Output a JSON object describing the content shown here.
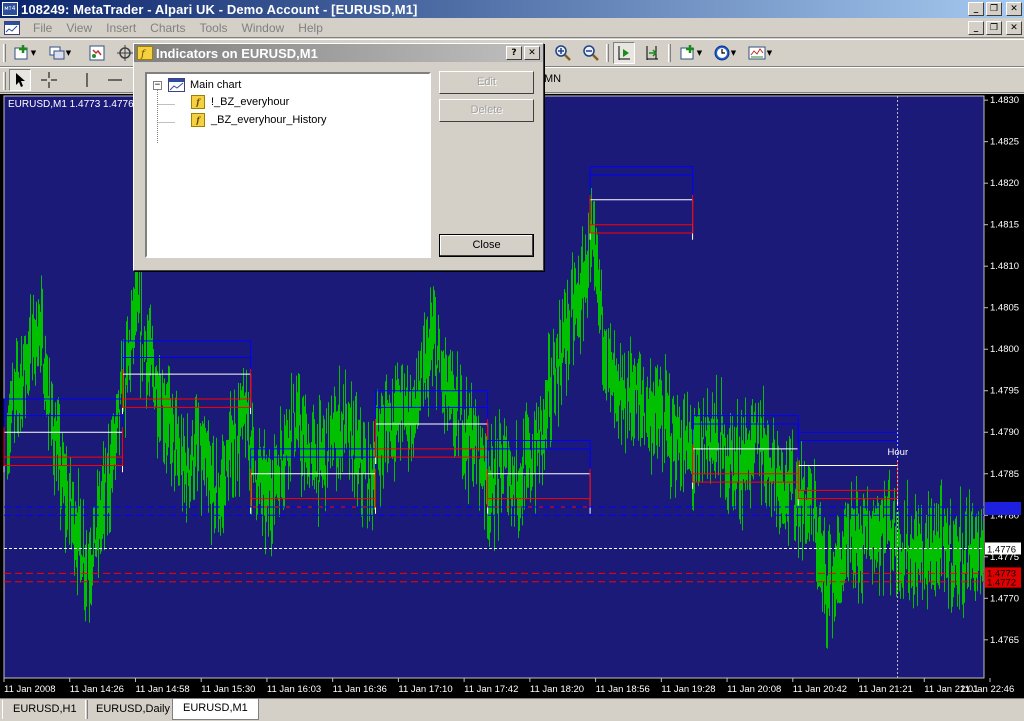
{
  "window": {
    "app_icon": "мт4",
    "title": "108249: MetaTrader - Alpari UK - Demo Account - [EURUSD,M1]"
  },
  "menu": [
    "File",
    "View",
    "Insert",
    "Charts",
    "Tools",
    "Window",
    "Help"
  ],
  "toolbar": {
    "period_label": "MN"
  },
  "chart": {
    "header": "EURUSD,M1  1.4773 1.4776",
    "indicator_label": "Hour",
    "bid_label": "1.4776",
    "blue_label": "",
    "red_label_1": "1.4773",
    "red_label_2": "1.4772",
    "colors": {
      "background": "#1c1a78",
      "candles": "#00c000",
      "upper": "#0000ff",
      "mid": "#ffffff",
      "lower": "#ff0000",
      "price_scale_bg": "#000000"
    }
  },
  "chart_data": {
    "type": "bar",
    "symbol": "EURUSD",
    "timeframe": "M1",
    "y_ticks": [
      1.483,
      1.4825,
      1.482,
      1.4815,
      1.481,
      1.4805,
      1.48,
      1.4795,
      1.479,
      1.4785,
      1.478,
      1.4775,
      1.477,
      1.4765
    ],
    "y_tick_labels": [
      "1.4830",
      "1.4825",
      "1.4820",
      "1.4815",
      "1.4810",
      "1.4805",
      "1.4800",
      "1.4795",
      "1.4790",
      "1.4785",
      "1.4780",
      "1.4775",
      "1.4770",
      "1.4765"
    ],
    "ylim": [
      1.476,
      1.4831
    ],
    "x_tick_labels": [
      "11 Jan 2008",
      "11 Jan 14:26",
      "11 Jan 14:58",
      "11 Jan 15:30",
      "11 Jan 16:03",
      "11 Jan 16:36",
      "11 Jan 17:10",
      "11 Jan 17:42",
      "11 Jan 18:20",
      "11 Jan 18:56",
      "11 Jan 19:28",
      "11 Jan 20:08",
      "11 Jan 20:42",
      "11 Jan 21:21",
      "11 Jan 22:01",
      "11 Jan 22:46"
    ],
    "hour_levels": [
      {
        "x0": 0.0,
        "x1": 1.85,
        "upper": [
          1.4794,
          1.4792
        ],
        "mid": 1.479,
        "lower": [
          1.4787,
          1.4786
        ]
      },
      {
        "x0": 1.85,
        "x1": 3.85,
        "upper": [
          1.4801,
          1.4799
        ],
        "mid": 1.4797,
        "lower": [
          1.4794,
          1.4793
        ]
      },
      {
        "x0": 3.85,
        "x1": 5.8,
        "upper": [
          1.4788,
          1.4787
        ],
        "mid": 1.4785,
        "lower": [
          1.4782,
          1.4781
        ]
      },
      {
        "x0": 5.8,
        "x1": 7.55,
        "upper": [
          1.4795,
          1.4793
        ],
        "mid": 1.4791,
        "lower": [
          1.4788,
          1.4787
        ]
      },
      {
        "x0": 7.55,
        "x1": 9.15,
        "upper": [
          1.4789,
          1.4788
        ],
        "mid": 1.4785,
        "lower": [
          1.4782,
          1.4781
        ]
      },
      {
        "x0": 9.15,
        "x1": 10.75,
        "upper": [
          1.4822,
          1.4821
        ],
        "mid": 1.4818,
        "lower": [
          1.4815,
          1.4814
        ]
      },
      {
        "x0": 10.75,
        "x1": 12.4,
        "upper": [
          1.4792,
          1.4791
        ],
        "mid": 1.4788,
        "lower": [
          1.4785,
          1.4784
        ]
      },
      {
        "x0": 12.4,
        "x1": 13.95,
        "upper": [
          1.479,
          1.4789
        ],
        "mid": 1.4786,
        "lower": [
          1.4783,
          1.4782
        ]
      }
    ],
    "dashed_levels": {
      "blue": [
        1.4781,
        1.478
      ],
      "white": 1.4776,
      "red": [
        1.4773,
        1.4772
      ]
    },
    "hour_marker_x": 13.95,
    "price_path": [
      [
        0.0,
        1.4788
      ],
      [
        0.2,
        1.4795
      ],
      [
        0.4,
        1.48
      ],
      [
        0.55,
        1.4803
      ],
      [
        0.7,
        1.4793
      ],
      [
        0.9,
        1.4784
      ],
      [
        1.1,
        1.4779
      ],
      [
        1.3,
        1.4774
      ],
      [
        1.45,
        1.4778
      ],
      [
        1.6,
        1.4783
      ],
      [
        1.75,
        1.479
      ],
      [
        1.9,
        1.4797
      ],
      [
        2.05,
        1.4805
      ],
      [
        2.2,
        1.48
      ],
      [
        2.4,
        1.4795
      ],
      [
        2.6,
        1.479
      ],
      [
        2.8,
        1.4785
      ],
      [
        3.0,
        1.4788
      ],
      [
        3.2,
        1.4784
      ],
      [
        3.35,
        1.4782
      ],
      [
        3.55,
        1.4788
      ],
      [
        3.75,
        1.4792
      ],
      [
        3.9,
        1.4786
      ],
      [
        4.1,
        1.4782
      ],
      [
        4.3,
        1.4786
      ],
      [
        4.5,
        1.4792
      ],
      [
        4.7,
        1.4788
      ],
      [
        4.9,
        1.4786
      ],
      [
        5.1,
        1.4789
      ],
      [
        5.3,
        1.4791
      ],
      [
        5.5,
        1.4787
      ],
      [
        5.7,
        1.4784
      ],
      [
        5.85,
        1.4789
      ],
      [
        6.0,
        1.4791
      ],
      [
        6.2,
        1.4793
      ],
      [
        6.4,
        1.4792
      ],
      [
        6.55,
        1.4797
      ],
      [
        6.7,
        1.4801
      ],
      [
        6.85,
        1.4796
      ],
      [
        7.05,
        1.4792
      ],
      [
        7.25,
        1.479
      ],
      [
        7.45,
        1.4787
      ],
      [
        7.6,
        1.4783
      ],
      [
        7.8,
        1.4786
      ],
      [
        8.0,
        1.4784
      ],
      [
        8.2,
        1.4786
      ],
      [
        8.4,
        1.479
      ],
      [
        8.55,
        1.4796
      ],
      [
        8.7,
        1.48
      ],
      [
        8.85,
        1.4804
      ],
      [
        9.0,
        1.4806
      ],
      [
        9.15,
        1.4812
      ],
      [
        9.3,
        1.4806
      ],
      [
        9.45,
        1.4797
      ],
      [
        9.6,
        1.4793
      ],
      [
        9.8,
        1.4795
      ],
      [
        10.0,
        1.4793
      ],
      [
        10.2,
        1.4792
      ],
      [
        10.4,
        1.479
      ],
      [
        10.6,
        1.4788
      ],
      [
        10.8,
        1.4787
      ],
      [
        11.0,
        1.479
      ],
      [
        11.2,
        1.4788
      ],
      [
        11.4,
        1.4786
      ],
      [
        11.6,
        1.4787
      ],
      [
        11.8,
        1.4789
      ],
      [
        12.0,
        1.4786
      ],
      [
        12.2,
        1.4784
      ],
      [
        12.4,
        1.4782
      ],
      [
        12.6,
        1.4781
      ],
      [
        12.8,
        1.4772
      ],
      [
        13.0,
        1.4773
      ],
      [
        13.2,
        1.4776
      ],
      [
        13.4,
        1.4777
      ],
      [
        13.6,
        1.4778
      ],
      [
        13.8,
        1.4779
      ],
      [
        14.0,
        1.4776
      ],
      [
        14.3,
        1.4775
      ],
      [
        14.6,
        1.4776
      ],
      [
        14.9,
        1.4775
      ],
      [
        15.2,
        1.4776
      ],
      [
        15.29,
        1.4774
      ]
    ]
  },
  "dialog": {
    "title": "Indicators on EURUSD,M1",
    "help_btn": "?",
    "close_btn": "✕",
    "tree": {
      "root": "Main chart",
      "items": [
        "!_BZ_everyhour",
        "_BZ_everyhour_History"
      ]
    },
    "buttons": {
      "edit": "Edit",
      "delete": "Delete",
      "close": "Close"
    }
  },
  "tabs": [
    "EURUSD,H1",
    "EURUSD,Daily",
    "EURUSD,M1"
  ]
}
